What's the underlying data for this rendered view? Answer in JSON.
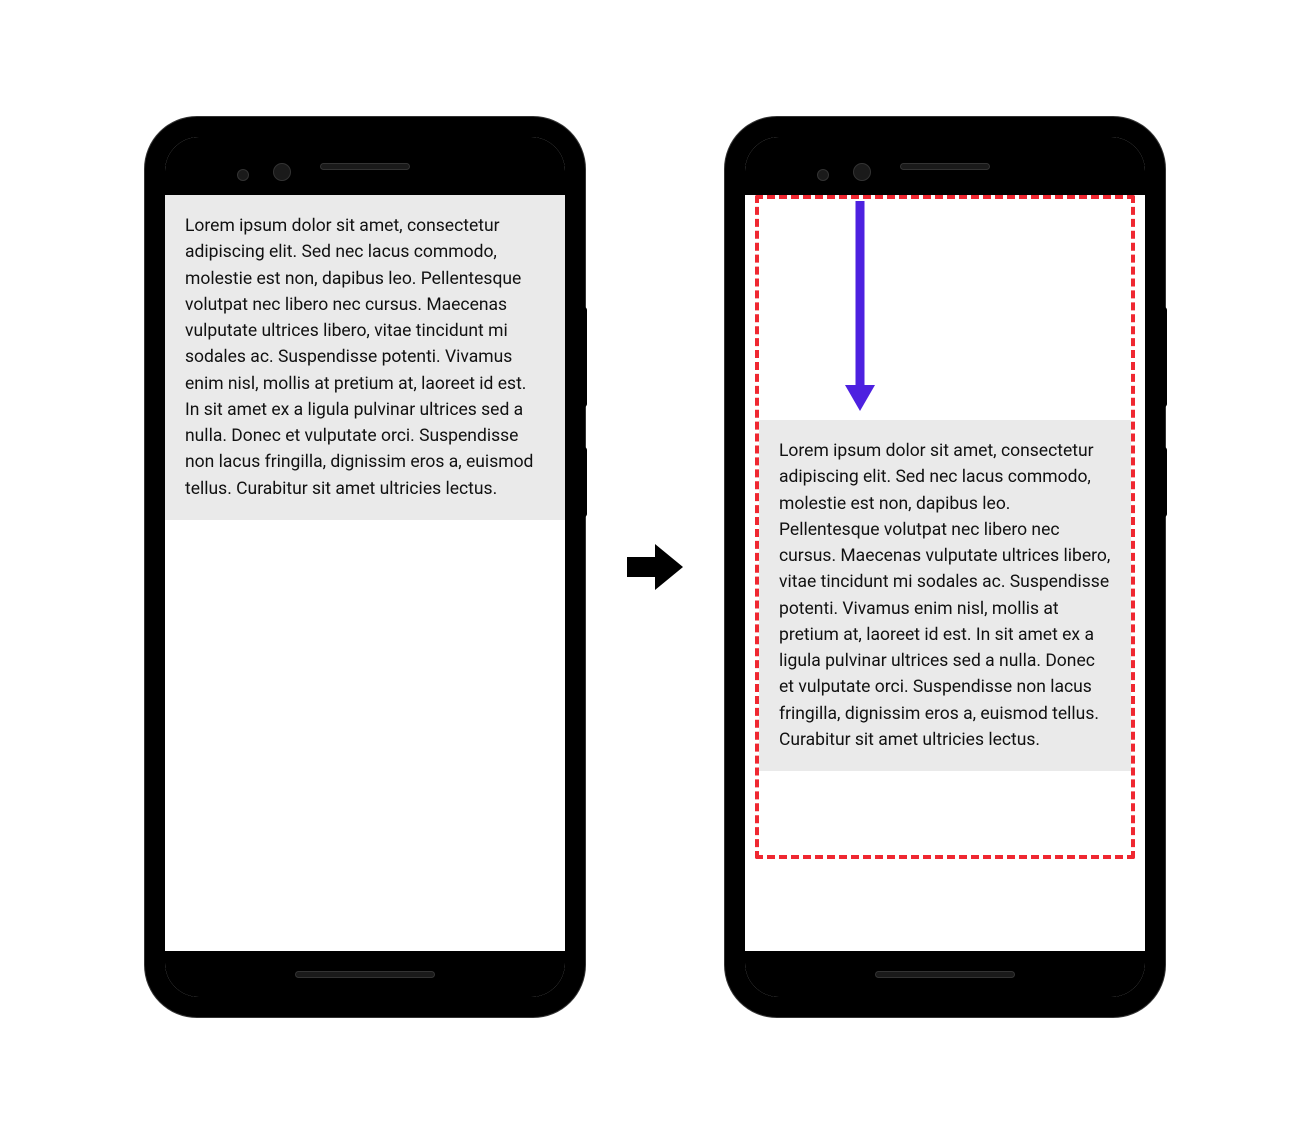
{
  "lorem_text": "Lorem ipsum dolor sit amet, consectetur adipiscing elit. Sed nec lacus commodo, molestie est non, dapibus leo. Pellentesque volutpat nec libero nec cursus. Maecenas vulputate ultrices libero, vitae tincidunt mi sodales ac. Suspendisse potenti. Vivamus enim nisl, mollis at pretium at, laoreet id est. In sit amet ex a ligula pulvinar ultrices sed a nulla. Donec et vulputate orci. Suspendisse non lacus fringilla, dignissim eros a, euismod tellus. Curabitur sit amet ultricies lectus.",
  "colors": {
    "highlight_border": "#ef2731",
    "arrow_down": "#4d21e0",
    "arrow_transition": "#000000",
    "text_bg": "#eaeaea"
  },
  "icons": {
    "transition": "right-arrow-icon",
    "down": "down-arrow-icon"
  }
}
